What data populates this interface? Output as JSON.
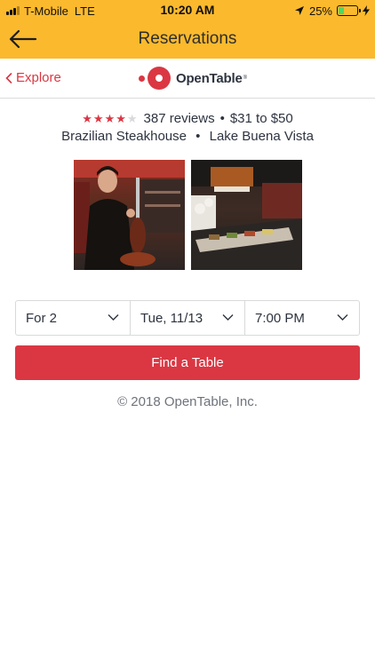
{
  "status_bar": {
    "carrier": "T-Mobile",
    "network": "LTE",
    "time": "10:20 AM",
    "battery_percent": "25%",
    "battery_level": 0.25
  },
  "header": {
    "title": "Reservations",
    "back_icon": "back-arrow-icon"
  },
  "brand_bar": {
    "back_label": "Explore",
    "logo_text": "OpenTable"
  },
  "restaurant": {
    "rating": 4,
    "rating_max": 5,
    "reviews": "387 reviews",
    "price_range": "$31 to $50",
    "cuisine": "Brazilian Steakhouse",
    "location": "Lake Buena Vista"
  },
  "booking": {
    "party_size": "For 2",
    "date": "Tue, 11/13",
    "time": "7:00 PM",
    "find_label": "Find a Table"
  },
  "footer": {
    "copyright": "© 2018 OpenTable, Inc."
  },
  "colors": {
    "header_bg": "#fbb92d",
    "brand_red": "#da3743",
    "text": "#2d333f",
    "muted": "#6f737b"
  }
}
